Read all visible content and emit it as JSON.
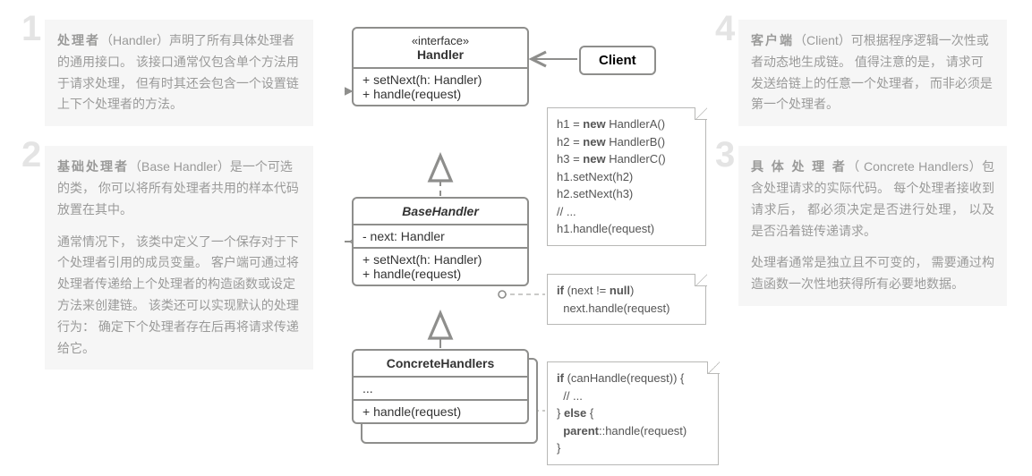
{
  "notes": {
    "n1": {
      "num": "1",
      "title": "处理者",
      "en": "（Handler）",
      "body": "声明了所有具体处理者的通用接口。 该接口通常仅包含单个方法用于请求处理， 但有时其还会包含一个设置链上下个处理者的方法。"
    },
    "n2": {
      "num": "2",
      "title": "基础处理者",
      "en": "（Base Handler）",
      "body1": "是一个可选的类， 你可以将所有处理者共用的样本代码放置在其中。",
      "body2": "通常情况下， 该类中定义了一个保存对于下个处理者引用的成员变量。 客户端可通过将处理者传递给上个处理者的构造函数或设定方法来创建链。 该类还可以实现默认的处理行为： 确定下个处理者存在后再将请求传递给它。"
    },
    "n3": {
      "num": "3",
      "title": "具 体 处 理 者",
      "en": "（ Concrete Handlers）",
      "body1": "包含处理请求的实际代码。 每个处理者接收到请求后， 都必须决定是否进行处理， 以及是否沿着链传递请求。",
      "body2": "处理者通常是独立且不可变的， 需要通过构造函数一次性地获得所有必要地数据。"
    },
    "n4": {
      "num": "4",
      "title": "客户端",
      "en": "（Client）",
      "body": "可根据程序逻辑一次性或者动态地生成链。 值得注意的是， 请求可发送给链上的任意一个处理者， 而非必须是第一个处理者。"
    }
  },
  "uml": {
    "handler": {
      "stereo": "«interface»",
      "name": "Handler",
      "m1": "+ setNext(h: Handler)",
      "m2": "+ handle(request)"
    },
    "base": {
      "name": "BaseHandler",
      "f1": "- next: Handler",
      "m1": "+ setNext(h: Handler)",
      "m2": "+ handle(request)"
    },
    "concrete": {
      "name": "ConcreteHandlers",
      "f1": "...",
      "m1": "+ handle(request)"
    },
    "client": {
      "name": "Client"
    }
  },
  "snippets": {
    "client": {
      "l1a": "h1 = ",
      "l1b": "new ",
      "l1c": "HandlerA()",
      "l2a": "h2 = ",
      "l2b": "new ",
      "l2c": "HandlerB()",
      "l3a": "h3 = ",
      "l3b": "new ",
      "l3c": "HandlerC()",
      "l4": "h1.setNext(h2)",
      "l5": "h2.setNext(h3)",
      "l6": "// ...",
      "l7": "h1.handle(request)"
    },
    "base": {
      "l1a": "if ",
      "l1b": "(next != ",
      "l1c": "null",
      "l1d": ")",
      "l2": "  next.handle(request)"
    },
    "concrete": {
      "l1a": "if ",
      "l1b": "(canHandle(request)) {",
      "l2": "  // ...",
      "l3a": "} ",
      "l3b": "else ",
      "l3c": "{",
      "l4a": "  ",
      "l4b": "parent",
      "l4c": "::handle(request)",
      "l5": "}"
    }
  }
}
